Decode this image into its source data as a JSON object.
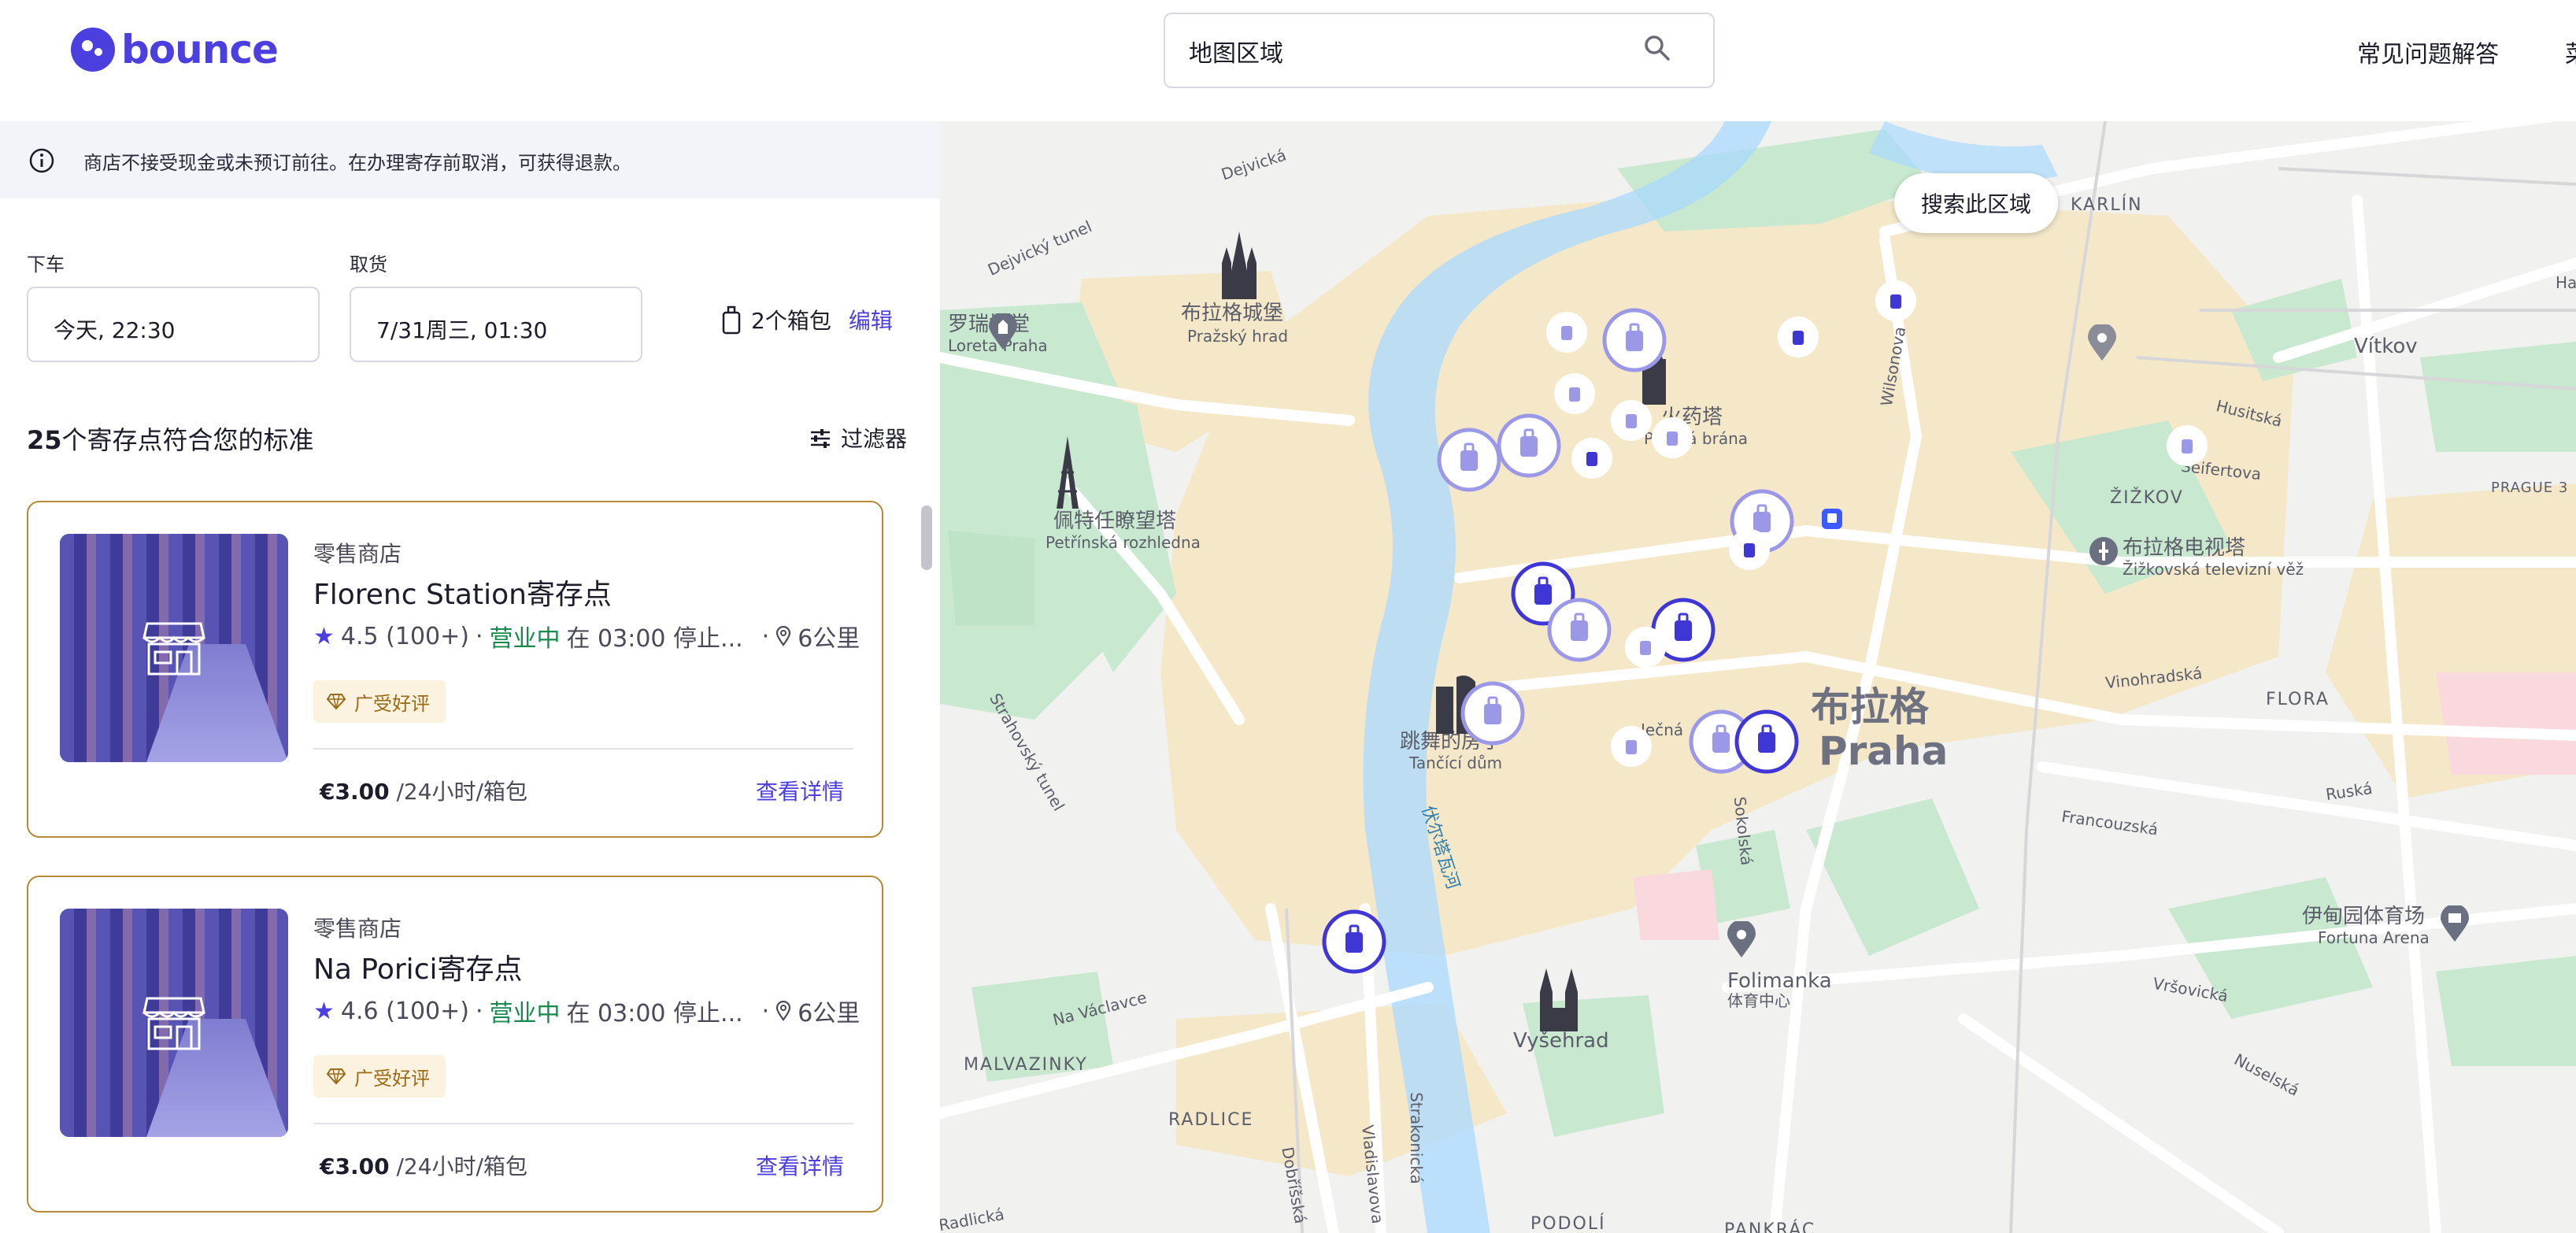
{
  "header": {
    "logo_text": "bounce",
    "search_value": "地图区域",
    "faq_label": "常见问题解答",
    "menu_label_cut": "菜"
  },
  "notice": {
    "text": "商店不接受现金或未预订前往。在办理寄存前取消，可获得退款。"
  },
  "booking": {
    "dropoff_label": "下车",
    "dropoff_value": "今天, 22:30",
    "pickup_label": "取货",
    "pickup_value": "7/31周三, 01:30",
    "bags_value": "2个箱包",
    "edit_label": "编辑"
  },
  "results": {
    "count_number": "25",
    "count_text": "个寄存点符合您的标准",
    "filters_label": "过滤器"
  },
  "listings": [
    {
      "category": "零售商店",
      "name": "Florenc Station寄存点",
      "rating": "4.5 (100+)",
      "sep1": "·",
      "status": "营业中",
      "closing": "在 03:00 停止...",
      "sep2": "·",
      "distance": "6公里",
      "badge": "广受好评",
      "price": "€3.00",
      "price_unit": "/24小时/箱包",
      "details_label": "查看详情"
    },
    {
      "category": "零售商店",
      "name": "Na Porici寄存点",
      "rating": "4.6 (100+)",
      "sep1": "·",
      "status": "营业中",
      "closing": "在 03:00 停止...",
      "sep2": "·",
      "distance": "6公里",
      "badge": "广受好评",
      "price": "€3.00",
      "price_unit": "/24小时/箱包",
      "details_label": "查看详情"
    }
  ],
  "map": {
    "search_area_label": "搜索此区域",
    "labels": {
      "dejvicka": "Dejvická",
      "dejvicky_tunel": "Dejvický tunel",
      "karlin": "KARLÍN",
      "loreta_cn": "罗瑞塔堂",
      "loreta": "Loreta Praha",
      "hrad_cn": "布拉格城堡",
      "hrad": "Pražský hrad",
      "vitkov": "Vítkov",
      "husitska": "Husitská",
      "wilsonova": "Wilsonova",
      "prasna_cn": "火药塔",
      "prasna": "Prašná brána",
      "seifertova": "Seifertova",
      "zizkov": "ŽIŽKOV",
      "prague3": "PRAGUE 3",
      "petrin_cn": "佩特任瞭望塔",
      "petrin": "Petřínská rozhledna",
      "tv_cn": "布拉格电视塔",
      "tv": "Žižkovská televizní věž",
      "strahov": "Strahovský tunel",
      "praha_cn": "布拉格",
      "praha": "Praha",
      "vinohradska": "Vinohradská",
      "flora": "FLORA",
      "jecna": "Ječná",
      "tanci_cn": "跳舞的房子",
      "tanci": "Tančící dům",
      "vltava": "伏尔塔瓦河",
      "sokolska": "Sokolská",
      "francouzska": "Francouzská",
      "ruska": "Ruská",
      "fortuna_cn": "伊甸园体育场",
      "fortuna": "Fortuna Arena",
      "folimanka": "Folimanka",
      "folimanka_cn": "体育中心",
      "vrsovicka": "Vršovická",
      "navaclavce": "Na Václavce",
      "vysehrad": "Vyšehrad",
      "malvaziny": "MALVAZINKY",
      "nuselska": "Nuselská",
      "radlice": "RADLICE",
      "strakonicka": "Strakonická",
      "dobrisska": "Dobříšská",
      "podoli": "PODOLÍ",
      "pankrac": "PANKRÁC",
      "vladislavova": "Vladislavova",
      "radlicka": "Radlická",
      "hana": "Ha"
    }
  },
  "colors": {
    "brand": "#4b3fe0",
    "open": "#178a4c",
    "badge_text": "#9b6a16",
    "card_border": "#b58a3a"
  }
}
